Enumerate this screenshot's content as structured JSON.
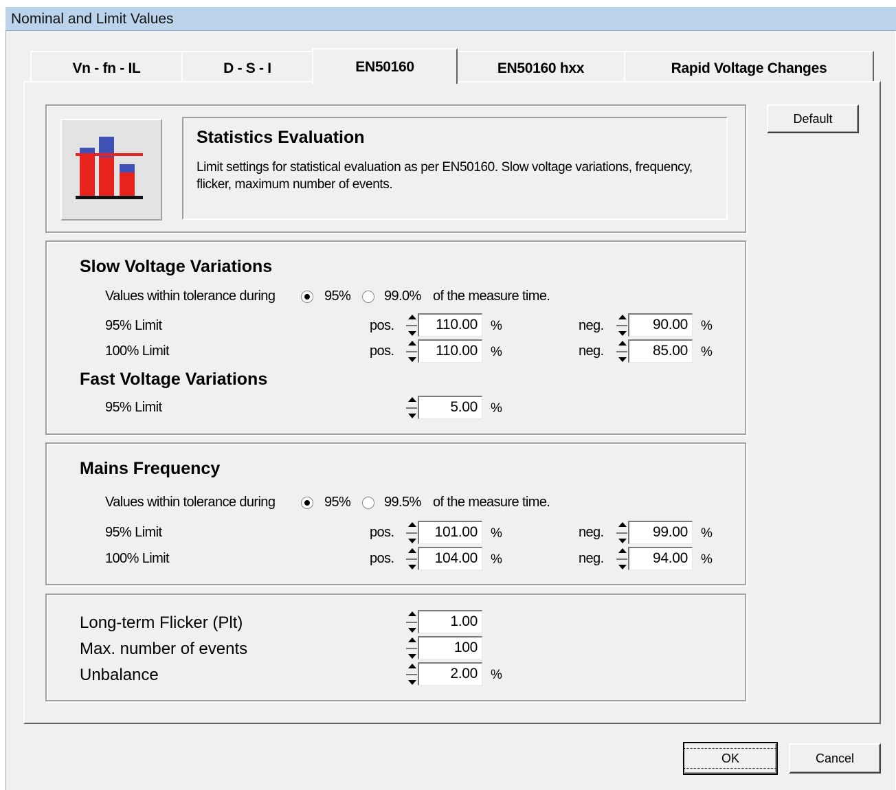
{
  "window": {
    "title": "Nominal and Limit Values"
  },
  "tabs": [
    "Vn - fn - IL",
    "D - S - I",
    "EN50160",
    "EN50160 hxx",
    "Rapid Voltage Changes"
  ],
  "active_tab": "EN50160",
  "header": {
    "title": "Statistics Evaluation",
    "description": "Limit settings for statistical evaluation as per EN50160. Slow voltage variations, frequency, flicker, maximum number of events.",
    "icon": "bar-chart-limit-icon",
    "icon_colors": {
      "bar": "#e8221c",
      "bar_top": "#3f51b5",
      "line": "#e8221c",
      "base": "#111111"
    }
  },
  "buttons": {
    "default": "Default",
    "ok": "OK",
    "cancel": "Cancel"
  },
  "slow_voltage": {
    "title": "Slow Voltage Variations",
    "tolerance_prefix": "Values within tolerance during",
    "option_a": "95%",
    "option_b": "99.0%",
    "tolerance_suffix": "of the measure time.",
    "selected": "95%",
    "limit95_label": "95% Limit",
    "limit100_label": "100% Limit",
    "pos_label": "pos.",
    "neg_label": "neg.",
    "limit95_pos": "110.00",
    "limit95_neg": "90.00",
    "limit100_pos": "110.00",
    "limit100_neg": "85.00",
    "unit": "%"
  },
  "fast_voltage": {
    "title": "Fast Voltage Variations",
    "limit95_label": "95% Limit",
    "limit95": "5.00",
    "unit": "%"
  },
  "mains_frequency": {
    "title": "Mains Frequency",
    "tolerance_prefix": "Values within tolerance during",
    "option_a": "95%",
    "option_b": "99.5%",
    "tolerance_suffix": "of the measure time.",
    "selected": "95%",
    "limit95_label": "95% Limit",
    "limit100_label": "100% Limit",
    "pos_label": "pos.",
    "neg_label": "neg.",
    "limit95_pos": "101.00",
    "limit95_neg": "99.00",
    "limit100_pos": "104.00",
    "limit100_neg": "94.00",
    "unit": "%"
  },
  "misc": {
    "flicker_label": "Long-term Flicker (Plt)",
    "flicker": "1.00",
    "events_label": "Max. number of events",
    "events": "100",
    "unbalance_label": "Unbalance",
    "unbalance": "2.00",
    "unit": "%"
  }
}
